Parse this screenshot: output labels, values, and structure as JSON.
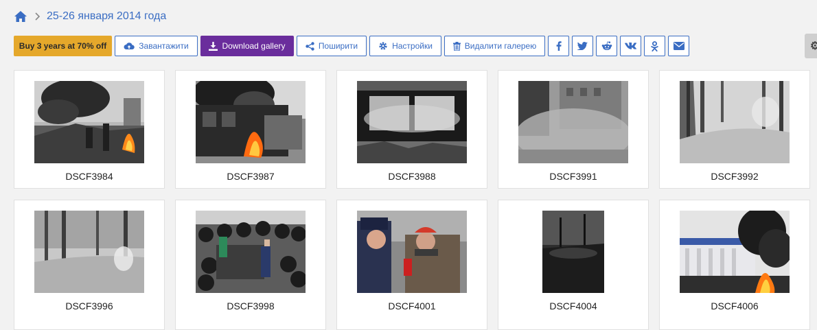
{
  "breadcrumb": {
    "title": "25-26 января 2014 года"
  },
  "toolbar": {
    "promo_label": "Buy 3 years at 70% off",
    "upload_label": "Завантажити",
    "download_label": "Download gallery",
    "share_label": "Поширити",
    "settings_label": "Настройки",
    "delete_label": "Видалити галерею"
  },
  "photos": [
    {
      "caption": "DSCF3984"
    },
    {
      "caption": "DSCF3987"
    },
    {
      "caption": "DSCF3988"
    },
    {
      "caption": "DSCF3991"
    },
    {
      "caption": "DSCF3992"
    },
    {
      "caption": "DSCF3996"
    },
    {
      "caption": "DSCF3998"
    },
    {
      "caption": "DSCF4001"
    },
    {
      "caption": "DSCF4004"
    },
    {
      "caption": "DSCF4006"
    }
  ],
  "colors": {
    "accent": "#3a6dc3",
    "promo": "#e5a82b",
    "download": "#6a2d9c"
  }
}
